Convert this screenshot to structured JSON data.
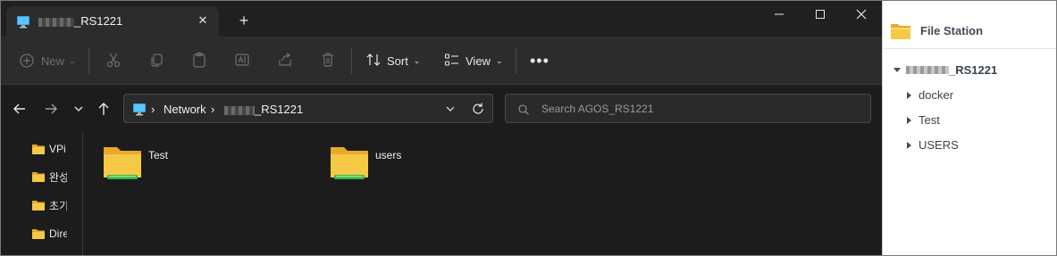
{
  "explorer": {
    "tab_title": "_RS1221",
    "toolbar": {
      "new_label": "New",
      "sort_label": "Sort",
      "view_label": "View"
    },
    "address": {
      "crumbs": [
        "Network",
        "_RS1221"
      ]
    },
    "search": {
      "placeholder": "Search AGOS_RS1221"
    },
    "nav_folders": [
      "VPi",
      "완성",
      "초기",
      "Dire"
    ],
    "content_folders": [
      "Test",
      "users"
    ]
  },
  "filestation": {
    "title": "File Station",
    "root_label": "_RS1221",
    "items": [
      "docker",
      "Test",
      "USERS"
    ]
  },
  "colors": {
    "folder_yellow": "#f6c945",
    "folder_back": "#e9a72b",
    "share_green": "#35b648",
    "accent_blue": "#2d8cff"
  }
}
